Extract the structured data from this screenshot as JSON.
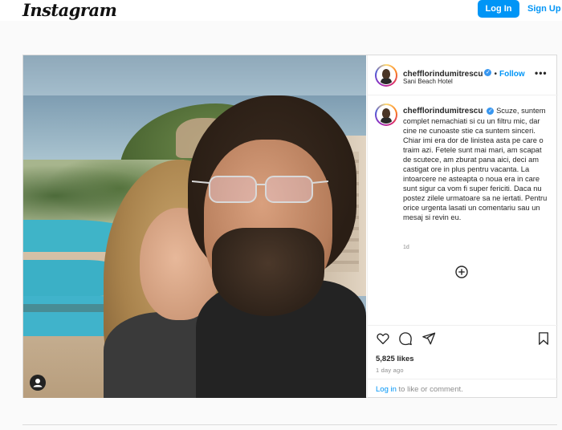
{
  "topbar": {
    "logo": "Instagram",
    "login_label": "Log In",
    "signup_label": "Sign Up"
  },
  "post": {
    "username": "chefflorindumitrescu",
    "follow_label": "Follow",
    "dot": "•",
    "location": "Sani Beach Hotel",
    "more": "•••",
    "caption": "Scuze, suntem complet nemachiati si cu un filtru mic, dar cine ne cunoaste stie ca suntem sinceri. Chiar imi era dor de linistea asta pe care o traim azi. Fetele sunt mai mari, am scapat de scutece, am zburat pana aici, deci am castigat ore in plus pentru vacanta. La intoarcere ne asteapta o noua era in care sunt sigur ca vom fi super fericiti. Daca nu postez zilele urmatoare sa ne iertati. Pentru orice urgenta lasati un comentariu sau un mesaj si revin eu.",
    "caption_time": "1d",
    "likes": "5,825 likes",
    "posted_ago": "1 day ago",
    "login_prompt_link": "Log in",
    "login_prompt_rest": " to like or comment."
  },
  "icons": {
    "like": "heart-icon",
    "comment": "comment-icon",
    "share": "send-icon",
    "save": "bookmark-icon",
    "load_more": "plus-circle-icon",
    "tagged": "user-icon",
    "verified": "verified-badge-icon"
  },
  "colors": {
    "accent": "#0095f6",
    "text": "#262626",
    "muted": "#8e8e8e",
    "border": "#dbdbdb",
    "verified": "#3897f0"
  }
}
